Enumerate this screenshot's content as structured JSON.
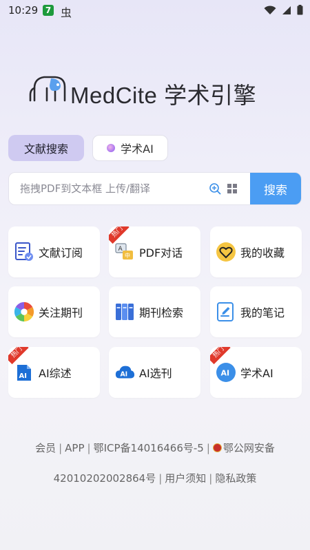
{
  "status_bar": {
    "time": "10:29",
    "app_badge_1": "7",
    "app_badge_2": "虫"
  },
  "logo": {
    "brand": "MedCite",
    "suffix": "学术引擎"
  },
  "tabs": [
    {
      "label": "文献搜索",
      "active": true
    },
    {
      "label": "学术AI",
      "active": false
    }
  ],
  "search": {
    "placeholder": "拖拽PDF到文本框 上传/翻译",
    "button_label": "搜索"
  },
  "features": [
    {
      "label": "文献订阅",
      "icon": "subscribe-doc-icon",
      "hot": false
    },
    {
      "label": "PDF对话",
      "icon": "translate-chat-icon",
      "hot": true
    },
    {
      "label": "我的收藏",
      "icon": "heart-icon",
      "hot": false
    },
    {
      "label": "关注期刊",
      "icon": "aperture-icon",
      "hot": false
    },
    {
      "label": "期刊检索",
      "icon": "journal-shelf-icon",
      "hot": false
    },
    {
      "label": "我的笔记",
      "icon": "note-edit-icon",
      "hot": false
    },
    {
      "label": "AI综述",
      "icon": "ai-doc-icon",
      "hot": true
    },
    {
      "label": "AI选刊",
      "icon": "ai-cloud-icon",
      "hot": false
    },
    {
      "label": "学术AI",
      "icon": "ai-user-icon",
      "hot": true
    }
  ],
  "hot_badge": "热门",
  "footer": {
    "line1": [
      "会员",
      "APP",
      "鄂ICP备14016466号-5",
      "鄂公网安备"
    ],
    "line2": [
      "42010202002864号",
      "用户须知",
      "隐私政策"
    ],
    "separator": "|"
  },
  "colors": {
    "accent": "#4b9df3",
    "tab_active_bg": "#cfcaf1",
    "hot_badge": "#e0392b"
  }
}
